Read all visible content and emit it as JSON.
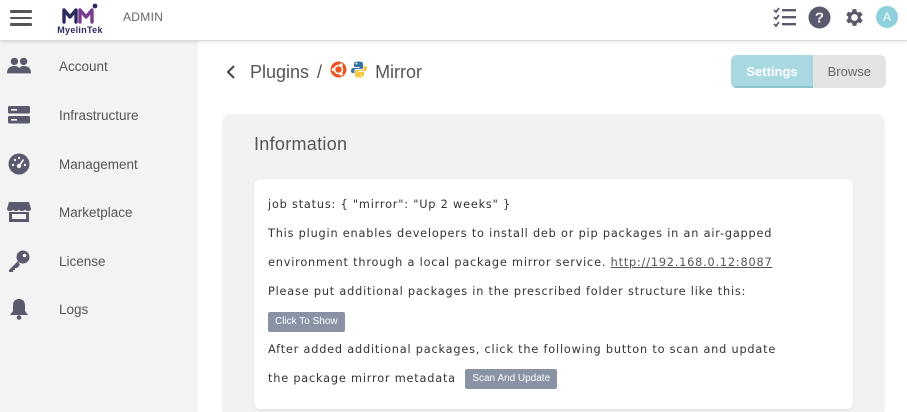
{
  "header": {
    "brand": "MyelinTek",
    "role_label": "ADMIN",
    "icons": [
      "checklist-icon",
      "help-icon",
      "settings-gear-icon"
    ],
    "avatar_initial": "A",
    "colors": {
      "brand": "#2b2a5e",
      "icon": "#5a5a6e",
      "avatar": "#8fd1db"
    }
  },
  "sidebar": {
    "items": [
      {
        "label": "Account",
        "icon": "users-icon"
      },
      {
        "label": "Infrastructure",
        "icon": "server-icon"
      },
      {
        "label": "Management",
        "icon": "dashboard-gauge-icon"
      },
      {
        "label": "Marketplace",
        "icon": "store-icon"
      },
      {
        "label": "License",
        "icon": "key-icon"
      },
      {
        "label": "Logs",
        "icon": "bell-icon"
      }
    ]
  },
  "breadcrumb": {
    "parent": "Plugins",
    "separator": "/",
    "current": "Mirror",
    "plugin_icons": [
      "ubuntu-icon",
      "python-icon"
    ]
  },
  "tabs": {
    "settings": "Settings",
    "browse": "Browse",
    "active": "Settings",
    "accent_color": "#a8d8e0"
  },
  "info": {
    "title": "Information",
    "job_status": "job status: { \"mirror\": \"Up 2 weeks\" }",
    "description_1": "This plugin enables developers to install deb or pip packages in an air-gapped",
    "description_2": "environment through a local package mirror service.",
    "mirror_url": "http://192.168.0.12:8087",
    "folder_note": "Please put additional packages in the prescribed folder structure like this:",
    "show_button": "Click To Show",
    "after_note_1": "After added additional packages, click the following button to scan and update",
    "after_note_2": "the package mirror metadata",
    "scan_button": "Scan And Update",
    "button_color": "#8a93a6"
  }
}
